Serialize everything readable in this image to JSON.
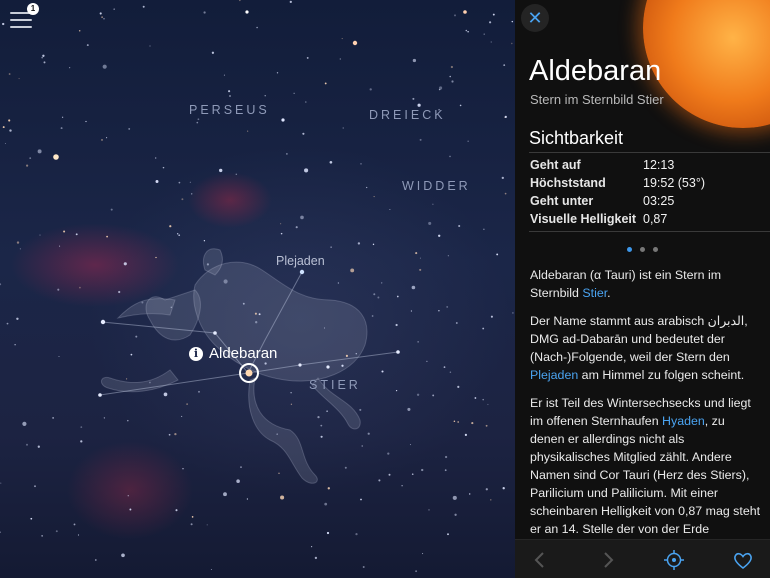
{
  "menu": {
    "badge": "1",
    "icon": "hamburger-menu-icon"
  },
  "sky": {
    "constellations": [
      {
        "id": "perseus",
        "label": "PERSEUS"
      },
      {
        "id": "dreieck",
        "label": "DREIECK"
      },
      {
        "id": "widder",
        "label": "WIDDER"
      },
      {
        "id": "stier",
        "label": "STIER"
      }
    ],
    "plejaden_label": "Plejaden",
    "selected_label": "Aldebaran",
    "info_icon": "i"
  },
  "panel": {
    "close_icon": "close-icon",
    "title": "Aldebaran",
    "subtitle": "Stern im Sternbild Stier",
    "visibility": {
      "heading": "Sichtbarkeit",
      "rows": [
        {
          "key": "Geht auf",
          "value": "12:13"
        },
        {
          "key": "Höchststand",
          "value": "19:52 (53°)"
        },
        {
          "key": "Geht unter",
          "value": "03:25"
        },
        {
          "key": "Visuelle Helligkeit",
          "value": "0,87"
        }
      ]
    },
    "page_dots": {
      "count": 3,
      "active": 0
    },
    "description": {
      "p1_a": "Aldebaran (α Tauri) ist ein Stern im Sternbild ",
      "p1_link": "Stier",
      "p1_b": ".",
      "p2_a": "Der Name stammt aus arabisch الدبران, DMG ad-Dabarān und bedeutet der (Nach-)Folgende, weil der Stern den ",
      "p2_link": "Plejaden",
      "p2_b": " am Himmel zu folgen scheint.",
      "p3_a": "Er ist Teil des Wintersechsecks und liegt im offenen Sternhaufen ",
      "p3_link": "Hyaden",
      "p3_b": ", zu denen er allerdings nicht als physikalisches Mitglied zählt. Andere Namen sind Cor Tauri (Herz des Stiers), Parilicium und Palilicium. Mit einer scheinbaren Helligkeit von 0,87 mag steht er an 14. Stelle der von der Erde"
    },
    "toolbar": {
      "back_icon": "chevron-left-icon",
      "forward_icon": "chevron-right-icon",
      "locate_icon": "crosshair-icon",
      "favorite_icon": "heart-icon"
    },
    "colors": {
      "accent": "#4aa3f0",
      "panel_bg": "#101010",
      "sky_bg": "#1b2648"
    }
  }
}
